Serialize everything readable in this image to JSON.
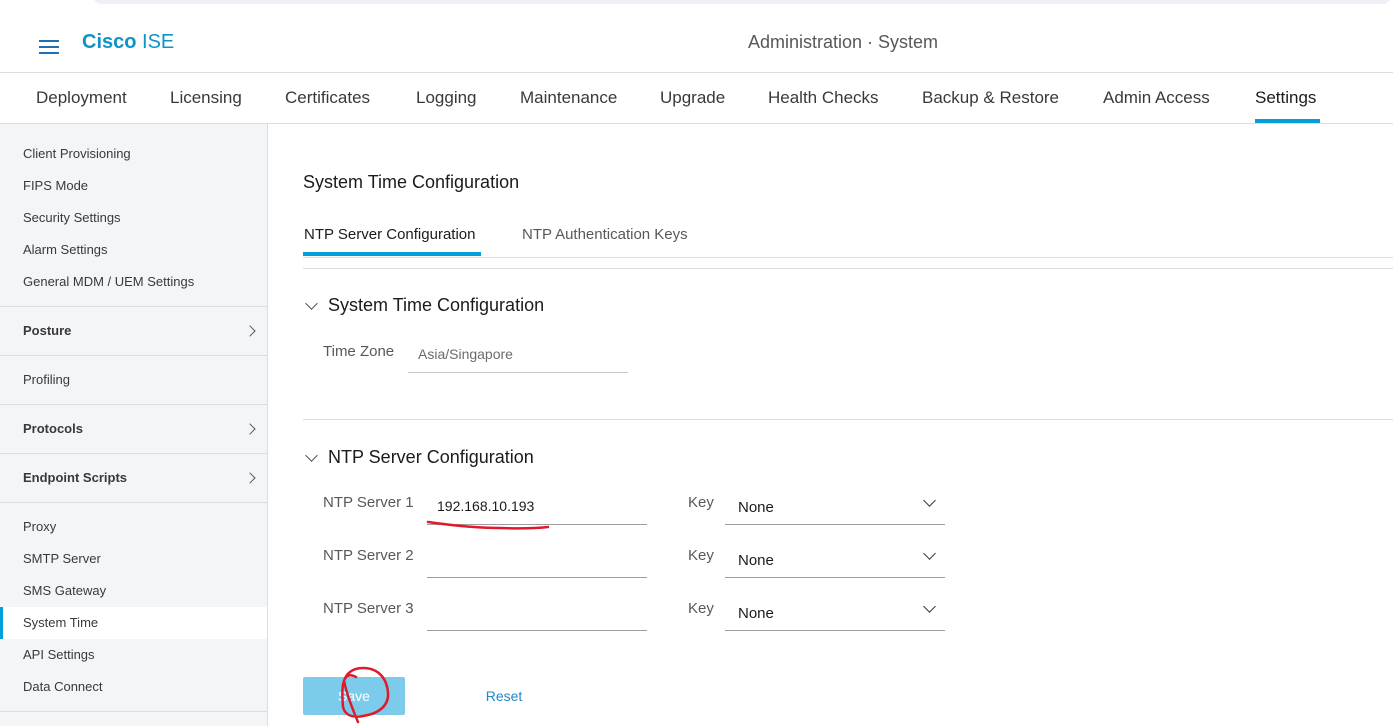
{
  "header": {
    "brand_bold": "Cisco",
    "brand_rest": " ISE",
    "title": "Administration · System"
  },
  "tabs": [
    {
      "label": "Deployment"
    },
    {
      "label": "Licensing"
    },
    {
      "label": "Certificates"
    },
    {
      "label": "Logging"
    },
    {
      "label": "Maintenance"
    },
    {
      "label": "Upgrade"
    },
    {
      "label": "Health Checks"
    },
    {
      "label": "Backup & Restore"
    },
    {
      "label": "Admin Access"
    },
    {
      "label": "Settings",
      "active": true
    }
  ],
  "sidebar": {
    "items": [
      {
        "label": "Client Provisioning"
      },
      {
        "label": "FIPS Mode"
      },
      {
        "label": "Security Settings"
      },
      {
        "label": "Alarm Settings"
      },
      {
        "label": "General MDM / UEM Settings"
      },
      {
        "label": "Posture",
        "group": true
      },
      {
        "label": "Profiling"
      },
      {
        "label": "Protocols",
        "group": true
      },
      {
        "label": "Endpoint Scripts",
        "group": true
      },
      {
        "label": "Proxy"
      },
      {
        "label": "SMTP Server"
      },
      {
        "label": "SMS Gateway"
      },
      {
        "label": "System Time",
        "active": true
      },
      {
        "label": "API Settings"
      },
      {
        "label": "Data Connect"
      }
    ]
  },
  "main": {
    "title": "System Time Configuration",
    "subtabs": [
      {
        "label": "NTP Server Configuration",
        "active": true
      },
      {
        "label": "NTP Authentication Keys"
      }
    ],
    "time_section": {
      "title": "System Time Configuration",
      "timezone_label": "Time Zone",
      "timezone_value": "Asia/Singapore"
    },
    "ntp_section": {
      "title": "NTP Server Configuration",
      "servers": [
        {
          "label": "NTP Server 1",
          "value": "192.168.10.193",
          "key_label": "Key",
          "key_value": "None"
        },
        {
          "label": "NTP Server 2",
          "value": "",
          "key_label": "Key",
          "key_value": "None"
        },
        {
          "label": "NTP Server 3",
          "value": "",
          "key_label": "Key",
          "key_value": "None"
        }
      ]
    },
    "buttons": {
      "save": "Save",
      "reset": "Reset"
    }
  },
  "colors": {
    "accent": "#049fd9",
    "save_button": "#7dcbea",
    "annotation_red": "#e0192b"
  }
}
